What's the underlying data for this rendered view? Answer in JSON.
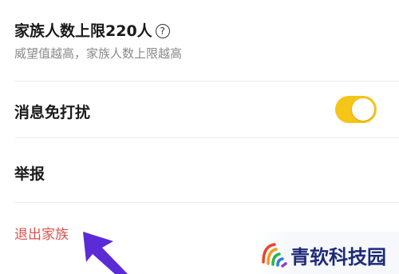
{
  "family_limit": {
    "title": "家族人数上限220人",
    "help_icon": "?",
    "subtitle": "威望值越高，家族人数上限越高"
  },
  "do_not_disturb": {
    "label": "消息免打扰",
    "toggle_on": true,
    "toggle_color": "#f5c518"
  },
  "report": {
    "label": "举报"
  },
  "exit_family": {
    "label": "退出家族",
    "color": "#d9534f"
  },
  "annotation": {
    "arrow_color": "#5a2bd6"
  },
  "watermark": {
    "text": "青软科技园"
  }
}
